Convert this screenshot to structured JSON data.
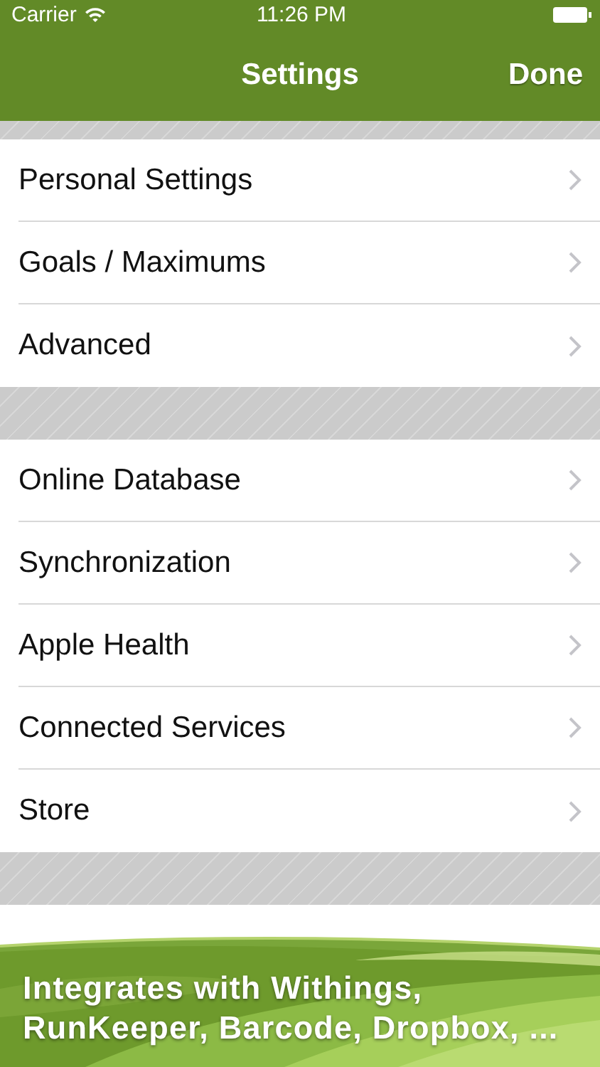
{
  "status_bar": {
    "carrier": "Carrier",
    "time": "11:26 PM"
  },
  "nav_bar": {
    "title": "Settings",
    "done_button": "Done"
  },
  "groups": [
    {
      "items": [
        {
          "label": "Personal Settings"
        },
        {
          "label": "Goals / Maximums"
        },
        {
          "label": "Advanced"
        }
      ]
    },
    {
      "items": [
        {
          "label": "Online Database"
        },
        {
          "label": "Synchronization"
        },
        {
          "label": "Apple Health"
        },
        {
          "label": "Connected Services"
        },
        {
          "label": "Store"
        }
      ]
    }
  ],
  "banner": {
    "lines": [
      "Integrates with Withings,",
      "RunKeeper, Barcode, Dropbox, ..."
    ]
  }
}
